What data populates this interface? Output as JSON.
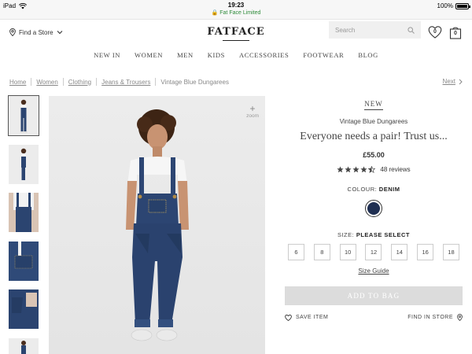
{
  "statusbar": {
    "device": "iPad",
    "time": "19:23",
    "site": "Fat Face Limited",
    "battery": "100%"
  },
  "header": {
    "find_store": "Find a Store",
    "logo": "FATFACE",
    "search_placeholder": "Search",
    "wishlist_count": "0",
    "bag_count": "0",
    "nav": [
      "NEW IN",
      "WOMEN",
      "MEN",
      "KIDS",
      "ACCESSORIES",
      "FOOTWEAR",
      "BLOG"
    ]
  },
  "breadcrumb": {
    "items": [
      "Home",
      "Women",
      "Clothing",
      "Jeans & Trousers"
    ],
    "current": "Vintage Blue Dungarees",
    "next": "Next"
  },
  "gallery": {
    "zoom": "zoom",
    "thumbnail_count": 6
  },
  "product": {
    "badge": "NEW",
    "name": "Vintage Blue Dungarees",
    "tagline": "Everyone needs a pair! Trust us...",
    "price": "£55.00",
    "rating": 4.5,
    "reviews": "48 reviews",
    "colour_label": "COLOUR:",
    "colour_value": "DENIM",
    "colour_hex": "#1f2f52",
    "size_label": "SIZE:",
    "size_value": "PLEASE SELECT",
    "sizes": [
      "6",
      "8",
      "10",
      "12",
      "14",
      "16",
      "18"
    ],
    "size_guide": "Size Guide",
    "add_to_bag": "ADD TO BAG",
    "save_item": "SAVE ITEM",
    "find_in_store": "FIND IN STORE"
  },
  "colors": {
    "accent_green": "#2e8b3a",
    "button_disabled": "#dcdcdc",
    "denim": "#2a3f66"
  }
}
